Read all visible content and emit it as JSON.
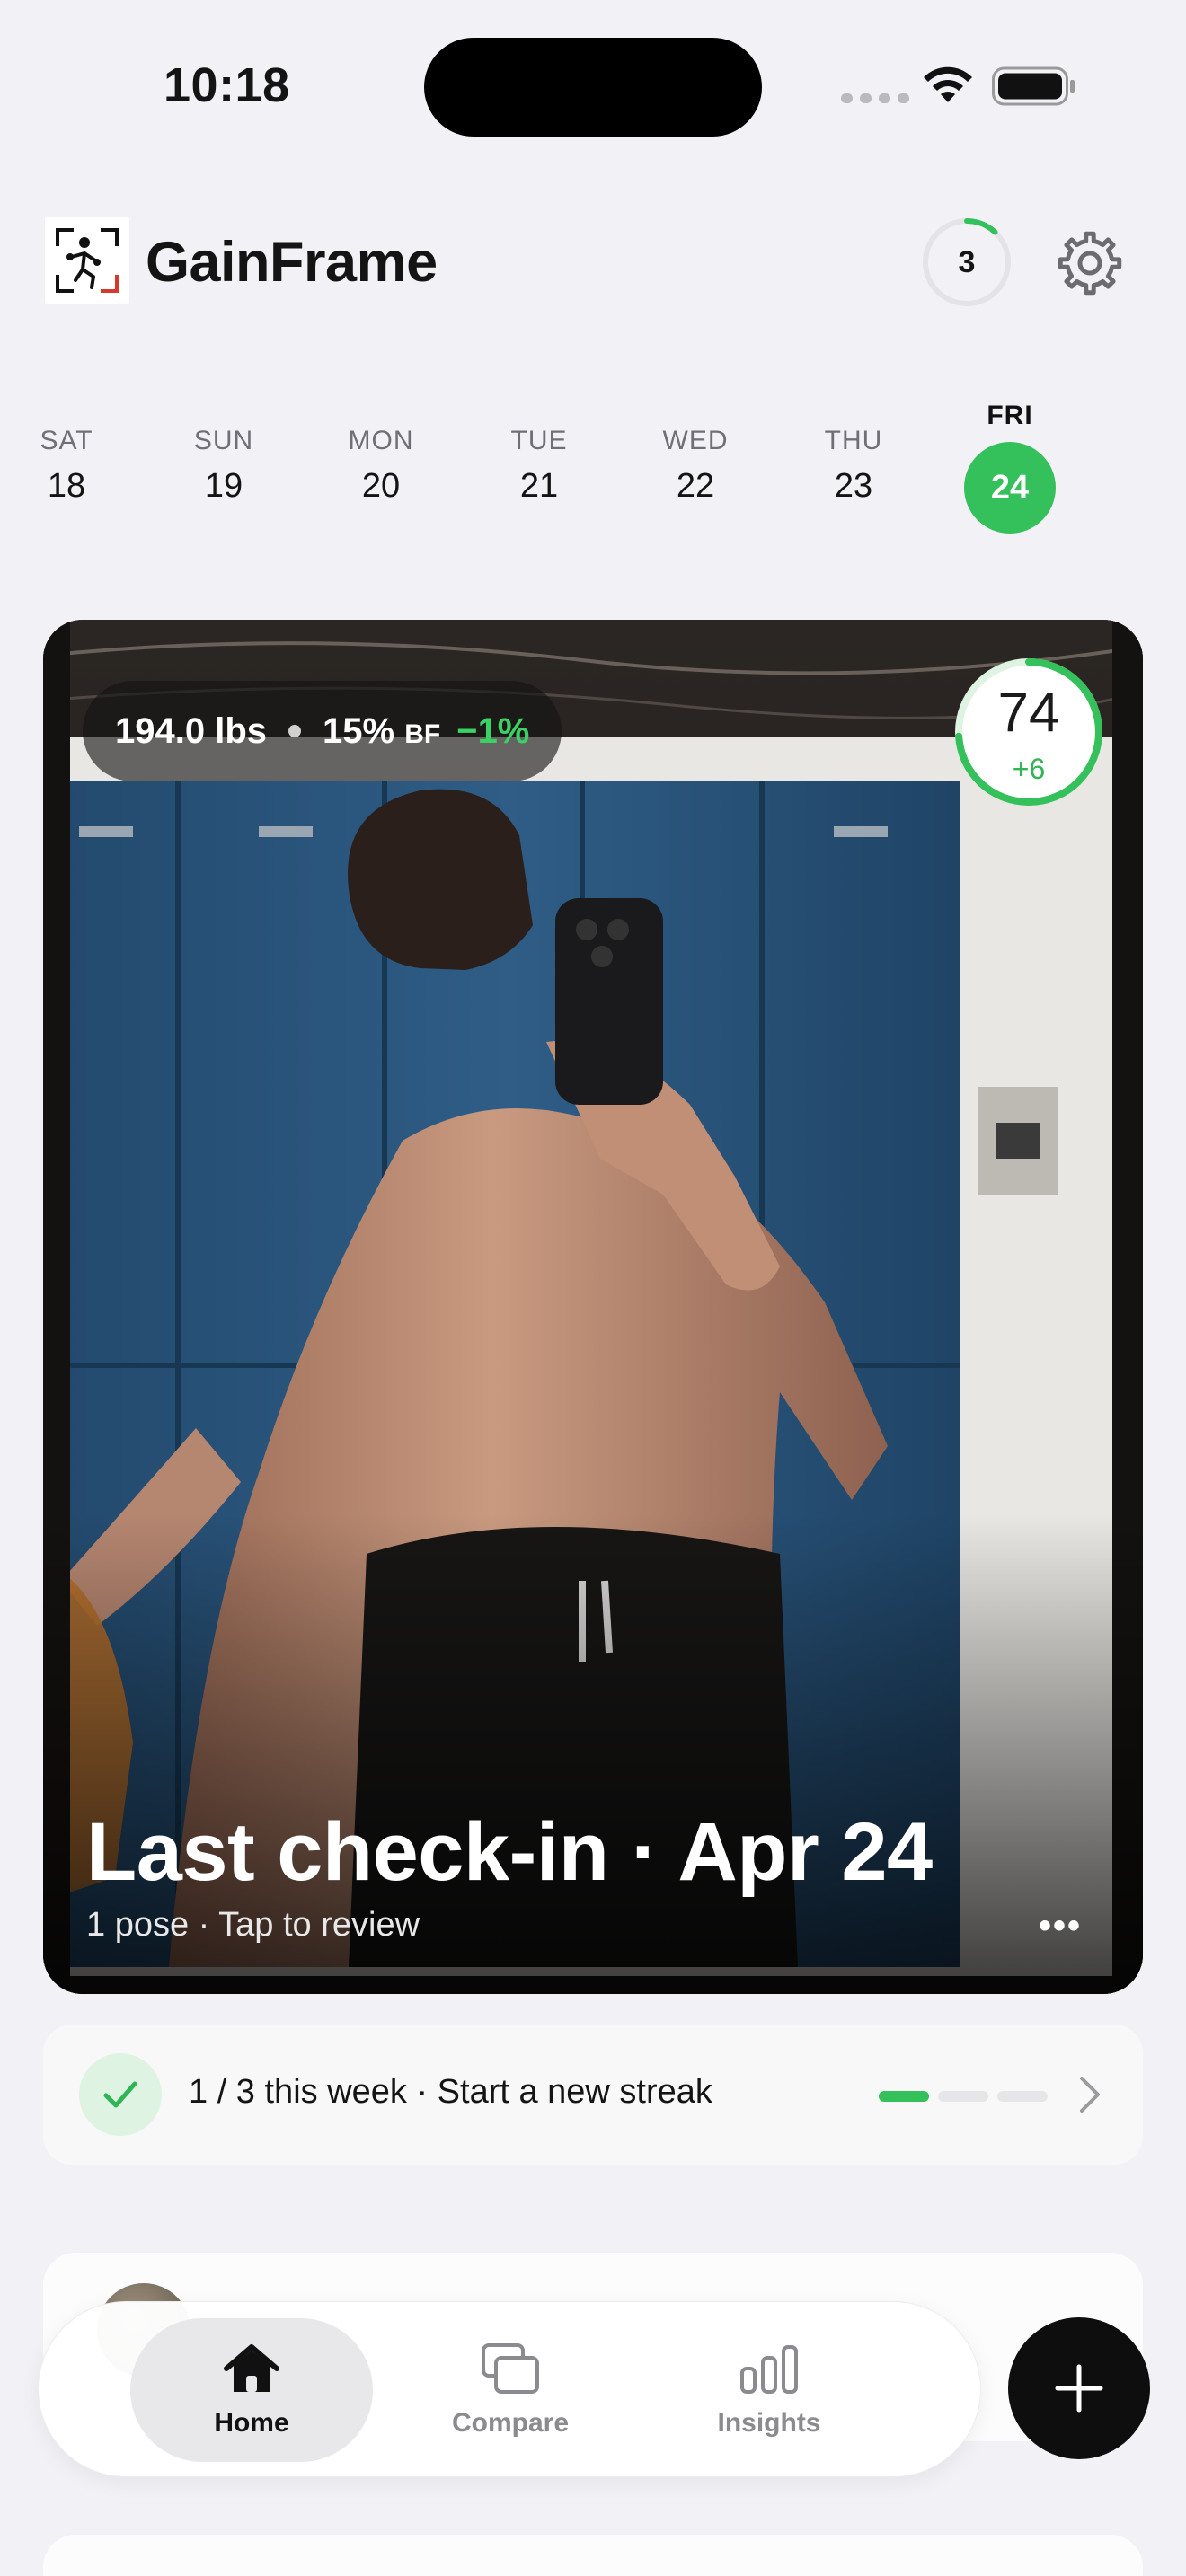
{
  "status_bar": {
    "time": "10:18"
  },
  "header": {
    "app_name": "GainFrame",
    "streak_count": "3",
    "streak_progress": 0.12
  },
  "week": [
    {
      "day": "SAT",
      "date": "18",
      "active": false
    },
    {
      "day": "SUN",
      "date": "19",
      "active": false
    },
    {
      "day": "MON",
      "date": "20",
      "active": false
    },
    {
      "day": "TUE",
      "date": "21",
      "active": false
    },
    {
      "day": "WED",
      "date": "22",
      "active": false
    },
    {
      "day": "THU",
      "date": "23",
      "active": false
    },
    {
      "day": "FRI",
      "date": "24",
      "active": true
    }
  ],
  "checkin_card": {
    "weight": "194.0 lbs",
    "body_fat": "15%",
    "body_fat_unit": "BF",
    "body_fat_delta": "−1%",
    "score": "74",
    "score_delta": "+6",
    "score_progress": 0.74,
    "title": "Last check-in · Apr 24",
    "subtitle": "1 pose · Tap to review",
    "more_label": "•••"
  },
  "weekly_progress": {
    "text": "1 / 3 this week · Start a new streak",
    "completed": 1,
    "total": 3
  },
  "tabbar": {
    "tabs": [
      {
        "label": "Home",
        "icon": "home-icon",
        "active": true
      },
      {
        "label": "Compare",
        "icon": "compare-icon",
        "active": false
      },
      {
        "label": "Insights",
        "icon": "insights-icon",
        "active": false
      }
    ],
    "fab_icon": "plus-icon"
  },
  "colors": {
    "accent_green": "#34c05a",
    "background": "#f2f2f6",
    "fab": "#0e0e0e"
  }
}
